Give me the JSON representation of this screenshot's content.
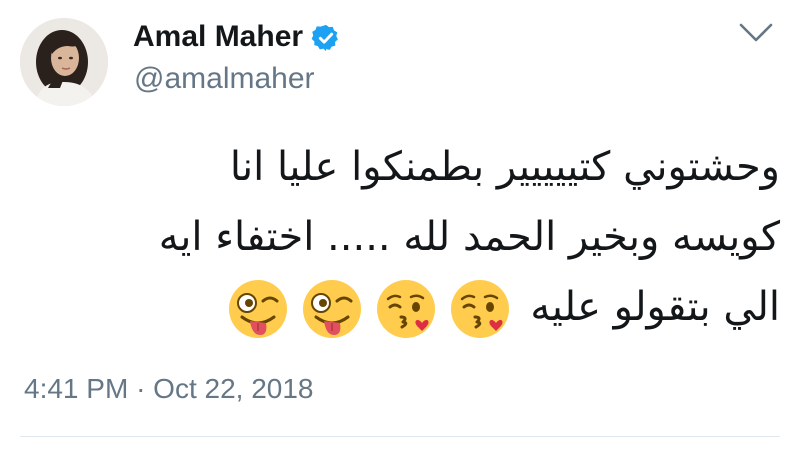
{
  "author": {
    "display_name": "Amal Maher",
    "handle": "@amalmaher",
    "verified": true,
    "avatar_icon": "profile-photo"
  },
  "tweet": {
    "lines": [
      "وحشتوني كتييييير بطمنكوا عليا انا",
      "كويسه وبخير الحمد لله ..... اختفاء ايه",
      "الي بتقولو عليه"
    ],
    "emojis": [
      "kissing-heart-emoji",
      "kissing-heart-emoji",
      "winking-tongue-emoji",
      "winking-tongue-emoji"
    ]
  },
  "meta": {
    "time": "4:41 PM",
    "separator": "·",
    "date": "Oct 22, 2018"
  },
  "menu": {
    "icon": "chevron-down-icon"
  },
  "colors": {
    "text": "#14171a",
    "secondary": "#657786",
    "verified": "#1da1f2",
    "divider": "#e1e8ed",
    "emoji_face": "#ffcc4d"
  }
}
